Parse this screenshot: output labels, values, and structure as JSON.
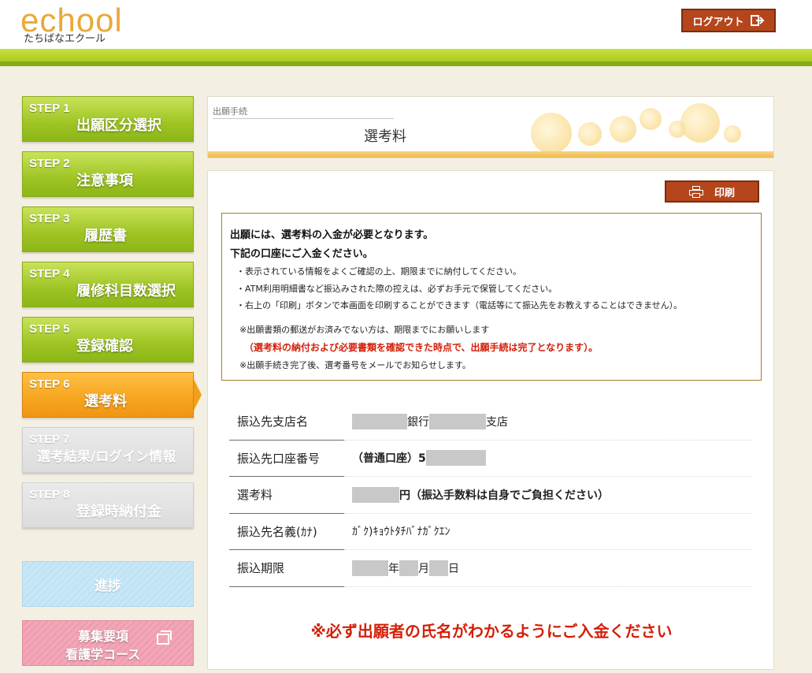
{
  "header": {
    "logo_main": "echool",
    "logo_sub": "たちばなエクール",
    "logout_label": "ログアウト"
  },
  "sidebar": {
    "steps": [
      {
        "num": "STEP 1",
        "label": "出願区分選択"
      },
      {
        "num": "STEP 2",
        "label": "注意事項"
      },
      {
        "num": "STEP 3",
        "label": "履歴書"
      },
      {
        "num": "STEP 4",
        "label": "履修科目数選択"
      },
      {
        "num": "STEP 5",
        "label": "登録確認"
      },
      {
        "num": "STEP 6",
        "label": "選考料"
      },
      {
        "num": "STEP 7",
        "label": "選考結果/ログイン情報"
      },
      {
        "num": "STEP 8",
        "label": "登録時納付金"
      }
    ],
    "progress_label": "進捗",
    "guide_line1": "募集要項",
    "guide_line2": "看護学コース"
  },
  "title_panel": {
    "breadcrumb": "出願手続",
    "title": "選考料"
  },
  "main": {
    "print_label": "印刷",
    "notice": {
      "heading1": "出願には、選考料の入金が必要となります。",
      "heading2": "下記の口座にご入金ください。",
      "bullet1": "・表示されている情報をよくご確認の上、期限までに納付してください。",
      "bullet2": "・ATM利用明細書など振込みされた際の控えは、必ずお手元で保管してください。",
      "bullet3": "・右上の「印刷」ボタンで本画面を印刷することができます（電話等にて振込先をお教えすることはできません）。",
      "note1": "※出願書類の郵送がお済みでない方は、期限までにお願いします",
      "note_red": "（選考料の納付および必要書類を確認できた時点で、出願手続は完了となります）。",
      "note2": "※出願手続き完了後、選考番号をメールでお知らせします。"
    },
    "table": {
      "branch_label": "振込先支店名",
      "branch_bank": "銀行",
      "branch_shop": "支店",
      "account_label": "振込先口座番号",
      "account_value": "（普通口座）5",
      "fee_label": "選考料",
      "fee_value": "円（振込手数料は自身でご負担ください）",
      "name_label": "振込先名義(ｶﾅ)",
      "name_value": "ｶﾞｸ)ｷｮｳﾄﾀﾁﾊﾞﾅｶﾞｸｴﾝ",
      "deadline_label": "振込期限",
      "deadline_year": "年",
      "deadline_month": "月",
      "deadline_day": "日"
    },
    "bottom_warning": "※必ず出願者の氏名がわかるようにご入金ください"
  }
}
